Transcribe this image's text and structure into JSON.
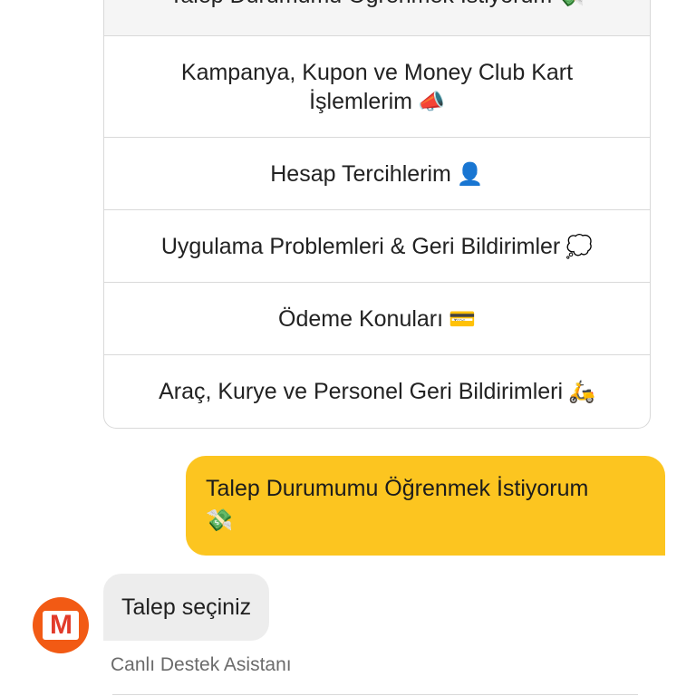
{
  "options": [
    {
      "label": "Talep Durumumu Öğrenmek İstiyorum",
      "emoji": "💸"
    },
    {
      "label": "Kampanya, Kupon ve Money Club Kart İşlemlerim",
      "emoji": "📣"
    },
    {
      "label": "Hesap Tercihlerim",
      "emoji": "👤"
    },
    {
      "label": "Uygulama Problemleri & Geri Bildirimler",
      "emoji": "💭"
    },
    {
      "label": "Ödeme Konuları",
      "emoji": "💳"
    },
    {
      "label": "Araç, Kurye ve Personel Geri Bildirimleri",
      "emoji": "🛵"
    }
  ],
  "user_message": {
    "text": "Talep Durumumu Öğrenmek İstiyorum",
    "emoji": "💸"
  },
  "bot_message": {
    "text": "Talep seçiniz"
  },
  "bot_avatar": {
    "letter": "M",
    "color": "#f25a14"
  },
  "sender_name": "Canlı Destek Asistanı",
  "colors": {
    "user_bubble": "#fcc520",
    "bot_bubble": "#ededed",
    "accent": "#f25a14"
  }
}
